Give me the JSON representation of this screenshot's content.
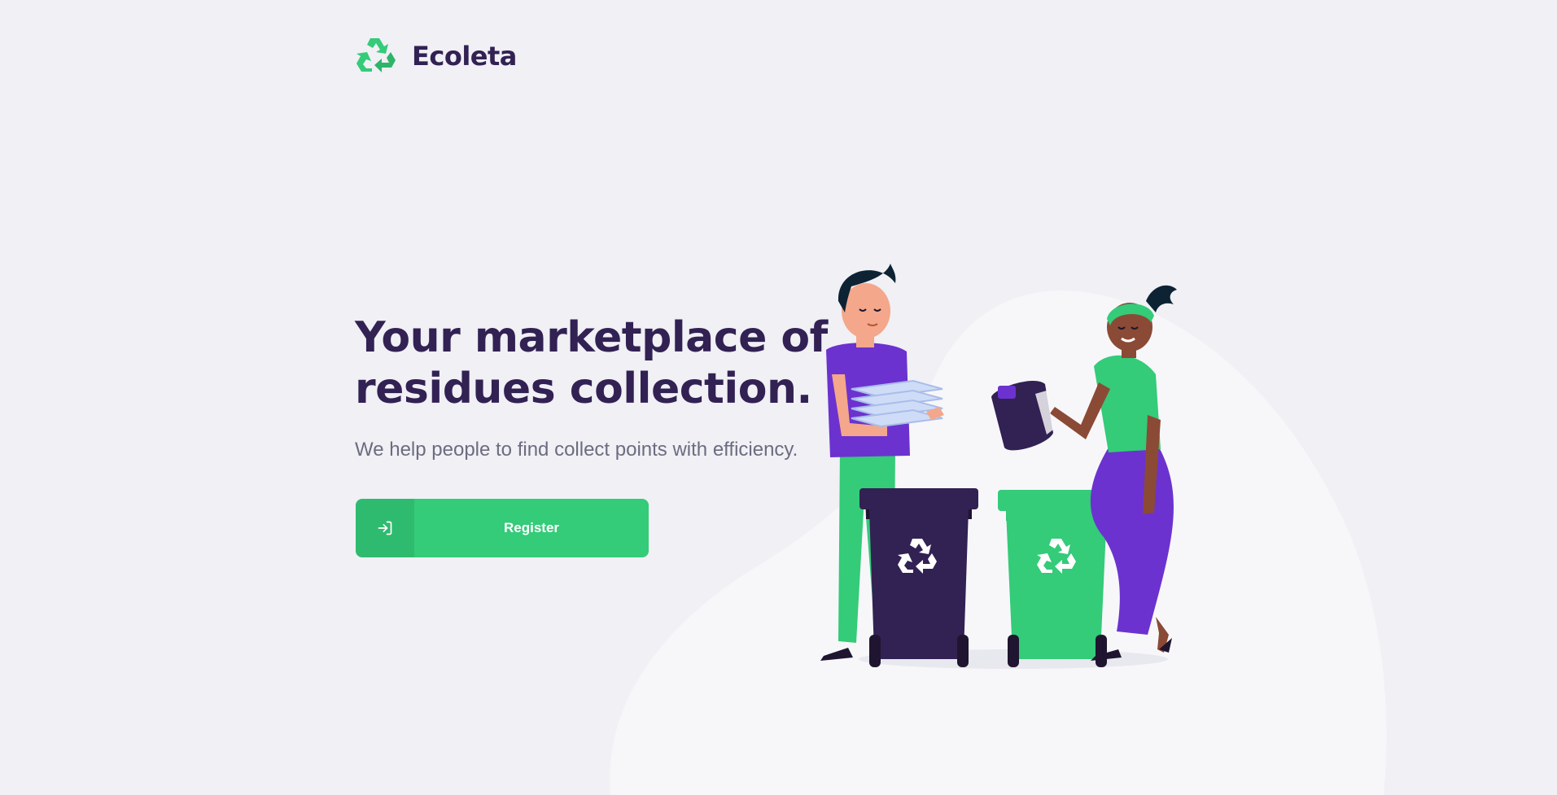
{
  "header": {
    "app_name": "Ecoleta",
    "logo_icon": "recycle-icon"
  },
  "hero": {
    "title_line1": "Your marketplace of",
    "title_line2": "residues collection.",
    "subtitle": "We help people to find collect points with efficiency."
  },
  "register_button": {
    "label": "Register",
    "icon": "login-arrow-icon"
  },
  "colors": {
    "primary": "#34cb79",
    "title": "#322153",
    "text": "#6c6c80",
    "background": "#f0f0f5"
  }
}
